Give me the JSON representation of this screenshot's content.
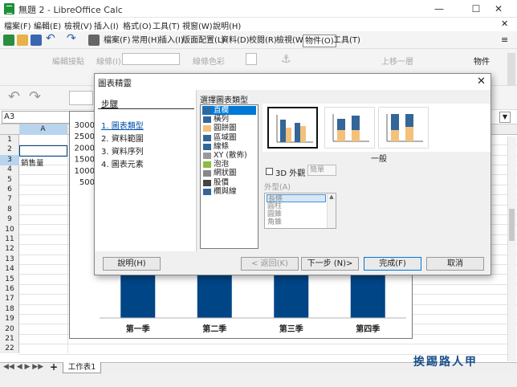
{
  "window": {
    "title": "無題 2 - LibreOffice Calc",
    "minimize": "—",
    "maximize": "☐",
    "close": "✕"
  },
  "menus": [
    "檔案(F)",
    "編輯(E)",
    "檢視(V)",
    "插入(I)",
    "格式(O)",
    "工具(T)",
    "視窗(W)",
    "說明(H)"
  ],
  "tabbar": [
    "檔案(F)",
    "常用(H)",
    "插入(I)",
    "版面配置(L)",
    "資料(D)",
    "校閱(R)",
    "檢視(W)",
    "物件(O)",
    "工具(T)"
  ],
  "toolbar2": {
    "edit_points": "編輯接點",
    "line_label": "線條(I)",
    "line_color": "線條色彩",
    "bring_forward": "上移一層",
    "object": "物件"
  },
  "namebox": "A3",
  "columns": {
    "a": "A"
  },
  "rows": [
    "1",
    "2",
    "3",
    "4",
    "5",
    "6",
    "7",
    "8",
    "9",
    "10",
    "11",
    "12",
    "13",
    "14",
    "15",
    "16",
    "17",
    "18",
    "19",
    "20",
    "21",
    "22"
  ],
  "cells": {
    "a3": "銷售量"
  },
  "chart_data": {
    "type": "bar",
    "categories": [
      "第一季",
      "第二季",
      "第三季",
      "第四季"
    ],
    "yticks": [
      "3000",
      "2500",
      "2000",
      "1500",
      "1000",
      "500"
    ],
    "bar_color": "#004586"
  },
  "sheet_tab": "工作表1",
  "watermark": "挨踢路人甲",
  "dialog": {
    "title": "圖表精靈",
    "steps_heading": "步驟",
    "steps": [
      "1. 圖表類型",
      "2. 資料範圍",
      "3. 資料序列",
      "4. 圖表元素"
    ],
    "choose_heading": "選擇圖表類型",
    "chart_types": [
      "直欄",
      "橫列",
      "圓餅圖",
      "區域圖",
      "線條",
      "XY (散佈)",
      "泡泡",
      "網狀圖",
      "股價",
      "欄與線"
    ],
    "variant_label": "一般",
    "three_d": "3D 外觀",
    "three_d_option": "簡單",
    "shape_label": "外型(A)",
    "shapes": [
      "長條",
      "圓柱",
      "圓錐",
      "角錐"
    ],
    "buttons": {
      "help": "說明(H)",
      "back": "< 返回(K)",
      "next": "下一步 (N)>",
      "finish": "完成(F)",
      "cancel": "取消"
    }
  },
  "colors": {
    "accent": "#0078d7",
    "bar": "#004586",
    "bar_alt": "#f4c17a",
    "bar_dark": "#336699"
  }
}
